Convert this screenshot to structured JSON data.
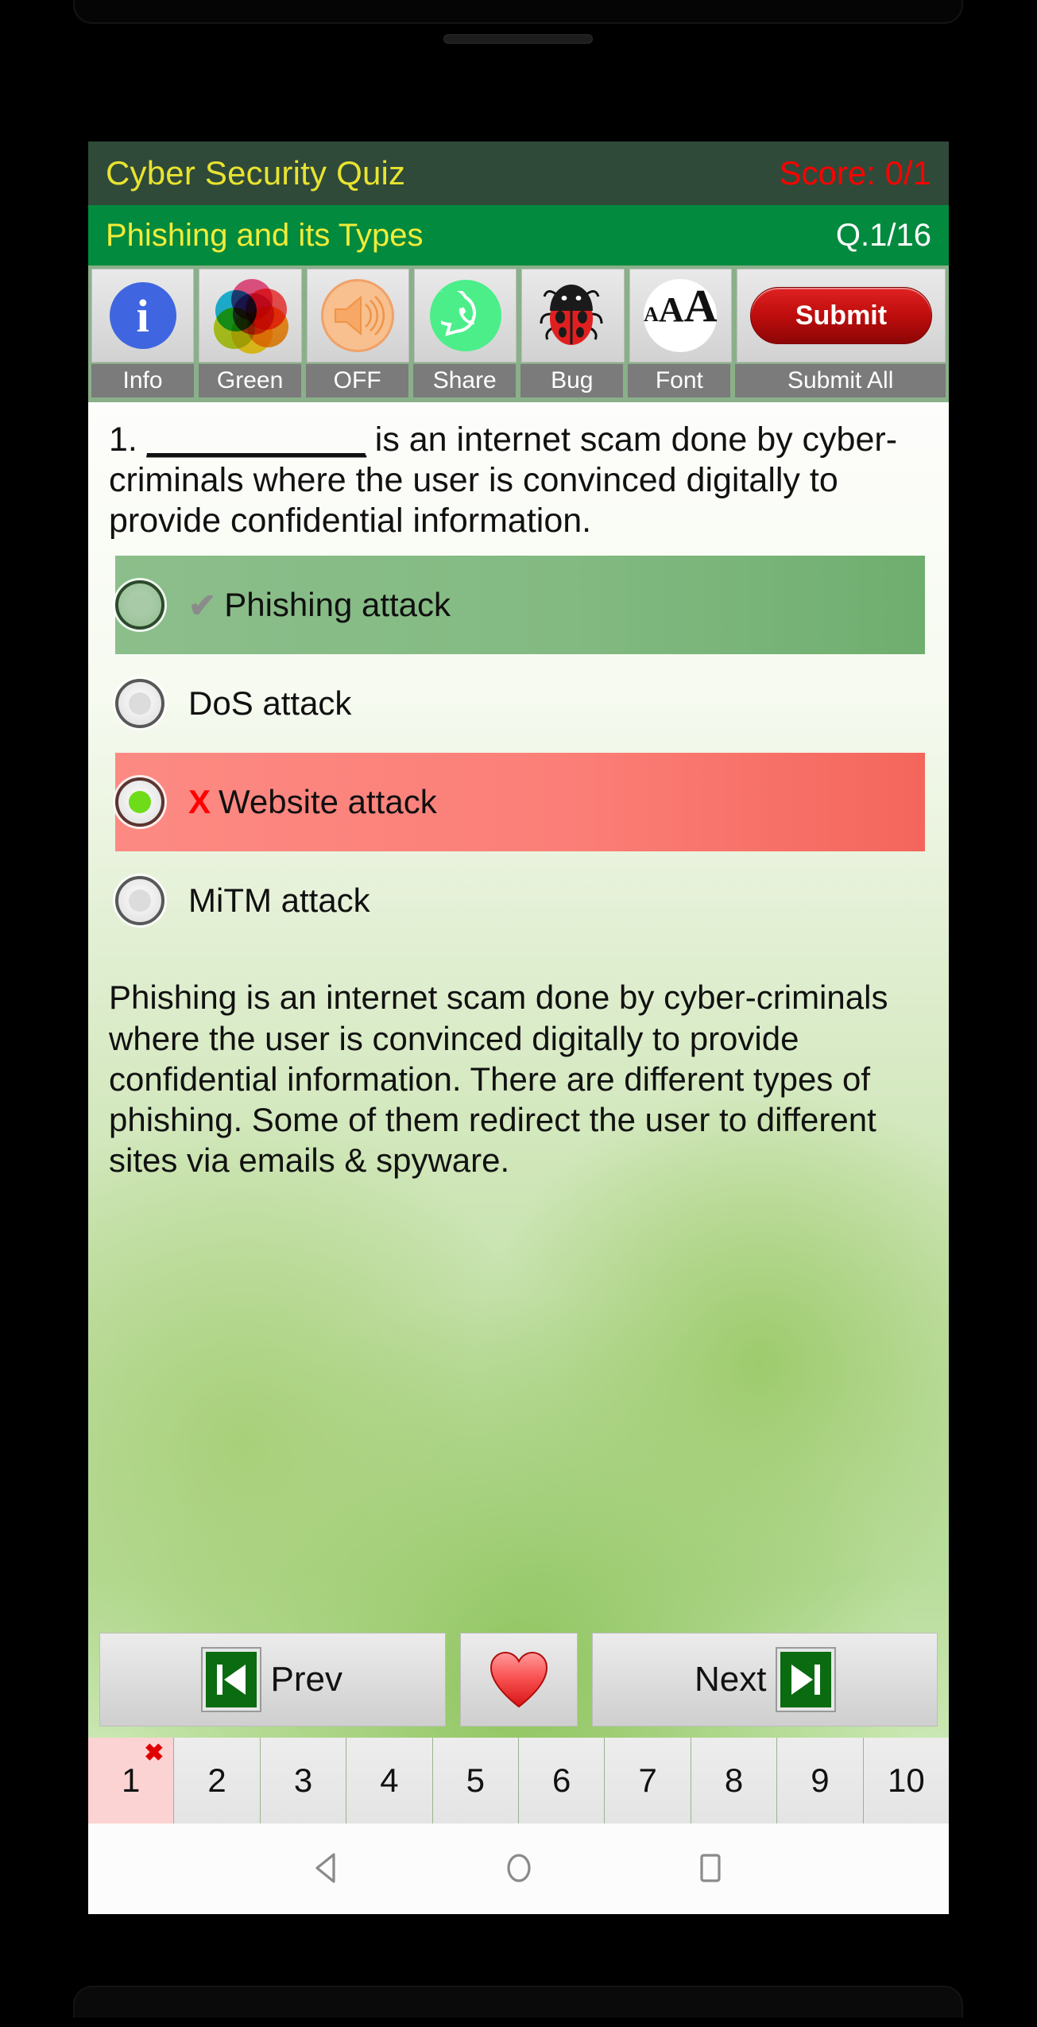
{
  "app": {
    "title": "Cyber Security Quiz",
    "score": "Score: 0/1",
    "topic": "Phishing and its Types",
    "question_counter": "Q.1/16"
  },
  "toolbar": {
    "items": [
      {
        "icon": "info-icon",
        "label": "Info"
      },
      {
        "icon": "color-palette-icon",
        "label": "Green"
      },
      {
        "icon": "speaker-icon",
        "label": "OFF"
      },
      {
        "icon": "whatsapp-share-icon",
        "label": "Share"
      },
      {
        "icon": "ladybug-icon",
        "label": "Bug"
      },
      {
        "icon": "font-size-icon",
        "label": "Font"
      }
    ],
    "submit_button": "Submit",
    "submit_label": "Submit All",
    "font_icon_text": {
      "small": "A",
      "medium": "A",
      "large": "A"
    }
  },
  "question": {
    "number": "1.",
    "blank": "____________",
    "text_after_blank": " is an internet scam done by cyber-criminals where the user is convinced digitally to provide confidential information."
  },
  "options": [
    {
      "label": "Phishing attack",
      "state": "correct",
      "mark": "✔",
      "selected": false
    },
    {
      "label": "DoS attack",
      "state": "neutral",
      "mark": "",
      "selected": false
    },
    {
      "label": "Website attack",
      "state": "wrong",
      "mark": "X",
      "selected": true
    },
    {
      "label": "MiTM attack",
      "state": "neutral",
      "mark": "",
      "selected": false
    }
  ],
  "explanation": "Phishing is an internet scam done by cyber-criminals where the user is convinced digitally to provide confidential information. There are different types of phishing. Some of them redirect the user to different sites via emails & spyware.",
  "navigation": {
    "prev_label": "Prev",
    "next_label": "Next",
    "favorite_icon": "heart-icon",
    "prev_icon": "skip-previous-icon",
    "next_icon": "skip-next-icon"
  },
  "pager": {
    "pages": [
      "1",
      "2",
      "3",
      "4",
      "5",
      "6",
      "7",
      "8",
      "9",
      "10"
    ],
    "current": "1",
    "current_mark": "✖"
  },
  "system_nav": {
    "back": "back-icon",
    "home": "home-icon",
    "recents": "recents-icon"
  },
  "colors": {
    "appbar": "#2f4a39",
    "topicbar": "#028a3e",
    "title_yellow": "#e8e330",
    "score_red": "#ff0000",
    "correct_green": "#83ba82",
    "wrong_red": "#fb7f78",
    "submit_red": "#c00d0d"
  }
}
